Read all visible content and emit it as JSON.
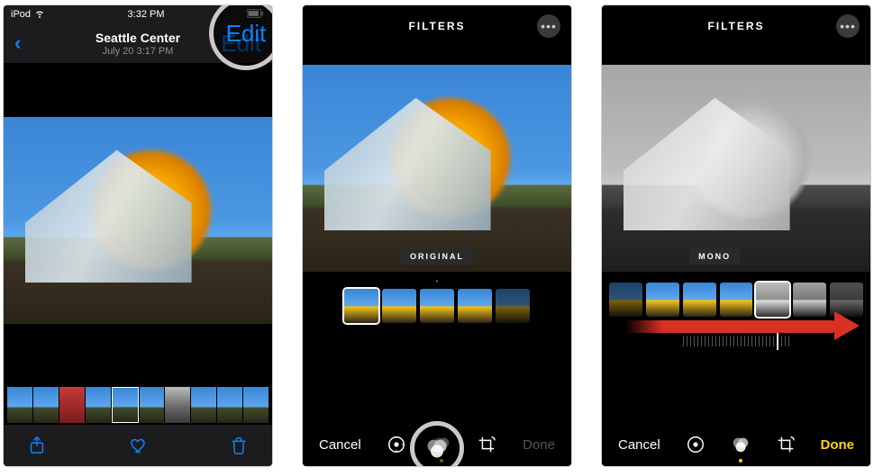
{
  "screen1": {
    "status": {
      "device": "iPod",
      "time": "3:32 PM"
    },
    "nav": {
      "location": "Seattle Center",
      "timestamp": "July 20  3:17 PM",
      "edit": "Edit"
    },
    "toolbar": {
      "share": "share-icon",
      "favorite": "heart-icon",
      "trash": "trash-icon"
    }
  },
  "screen2": {
    "title": "FILTERS",
    "badge": "ORIGINAL",
    "toolbar": {
      "cancel": "Cancel",
      "done": "Done"
    }
  },
  "screen3": {
    "title": "FILTERS",
    "badge": "MONO",
    "toolbar": {
      "cancel": "Cancel",
      "done": "Done"
    }
  }
}
